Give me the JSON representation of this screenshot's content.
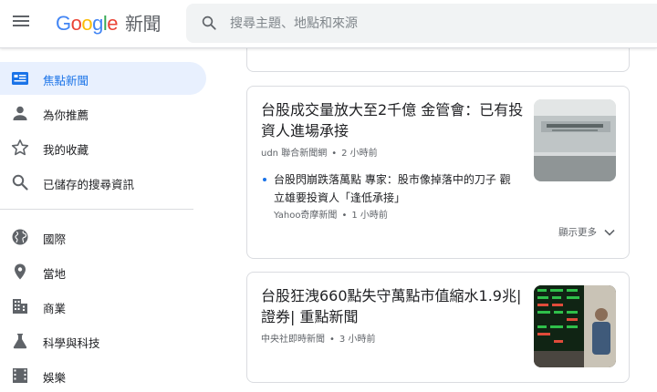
{
  "header": {
    "logo_google": [
      "G",
      "o",
      "o",
      "g",
      "l",
      "e"
    ],
    "logo_news": "新聞",
    "search_placeholder": "搜尋主題、地點和來源"
  },
  "sidebar": {
    "items": [
      {
        "label": "焦點新聞",
        "icon": "top-stories-icon",
        "active": true
      },
      {
        "label": "為你推薦",
        "icon": "person-icon"
      },
      {
        "label": "我的收藏",
        "icon": "star-icon"
      },
      {
        "label": "已儲存的搜尋資訊",
        "icon": "search-icon"
      },
      {
        "label": "國際",
        "icon": "globe-icon"
      },
      {
        "label": "當地",
        "icon": "location-pin-icon"
      },
      {
        "label": "商業",
        "icon": "building-icon"
      },
      {
        "label": "科學與科技",
        "icon": "flask-icon"
      },
      {
        "label": "娛樂",
        "icon": "movie-icon"
      }
    ]
  },
  "articles": [
    {
      "title": "台股成交量放大至2千億 金管會：已有投資人進場承接",
      "source": "udn 聯合新聞網",
      "time": "2 小時前",
      "related": {
        "title": "台股閃崩跌落萬點 專家：股市像掉落中的刀子 觀立雄要投資人「逢低承接」",
        "source": "Yahoo奇摩新聞",
        "time": "1 小時前"
      },
      "more_label": "顯示更多"
    },
    {
      "title": "台股狂洩660點失守萬點市值縮水1.9兆| 證券| 重點新聞",
      "source": "中央社即時新聞",
      "time": "3 小時前"
    }
  ],
  "colors": {
    "accent": "#1a73e8",
    "active_bg": "#e8f0fe",
    "icon_gray": "#5f6368",
    "search_bg": "#f1f3f4"
  }
}
